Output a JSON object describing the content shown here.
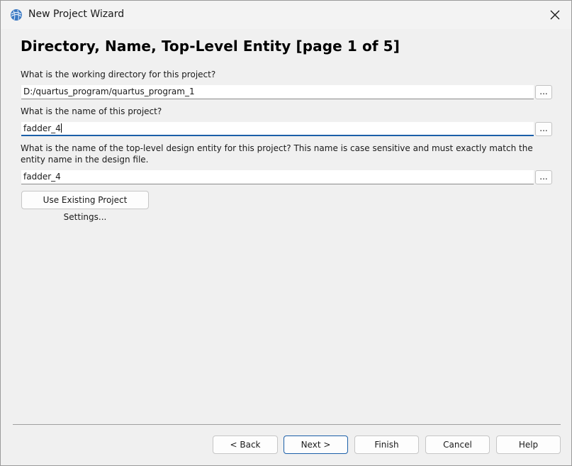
{
  "window": {
    "title": "New Project Wizard"
  },
  "page": {
    "heading": "Directory, Name, Top-Level Entity [page 1 of 5]"
  },
  "fields": {
    "directory": {
      "label": "What is the working directory for this project?",
      "value": "D:/quartus_program/quartus_program_1",
      "browse_label": "..."
    },
    "project_name": {
      "label": "What is the name of this project?",
      "value": "fadder_4",
      "browse_label": "..."
    },
    "top_entity": {
      "label": "What is the name of the top-level design entity for this project? This name is case sensitive and must exactly match the entity name in the design file.",
      "value": "fadder_4",
      "browse_label": "..."
    }
  },
  "existing_settings_button": "Use Existing Project Settings...",
  "footer": {
    "back": "< Back",
    "next": "Next >",
    "finish": "Finish",
    "cancel": "Cancel",
    "help": "Help"
  },
  "colors": {
    "accent": "#1b5fa8",
    "background": "#f0f0f0"
  }
}
